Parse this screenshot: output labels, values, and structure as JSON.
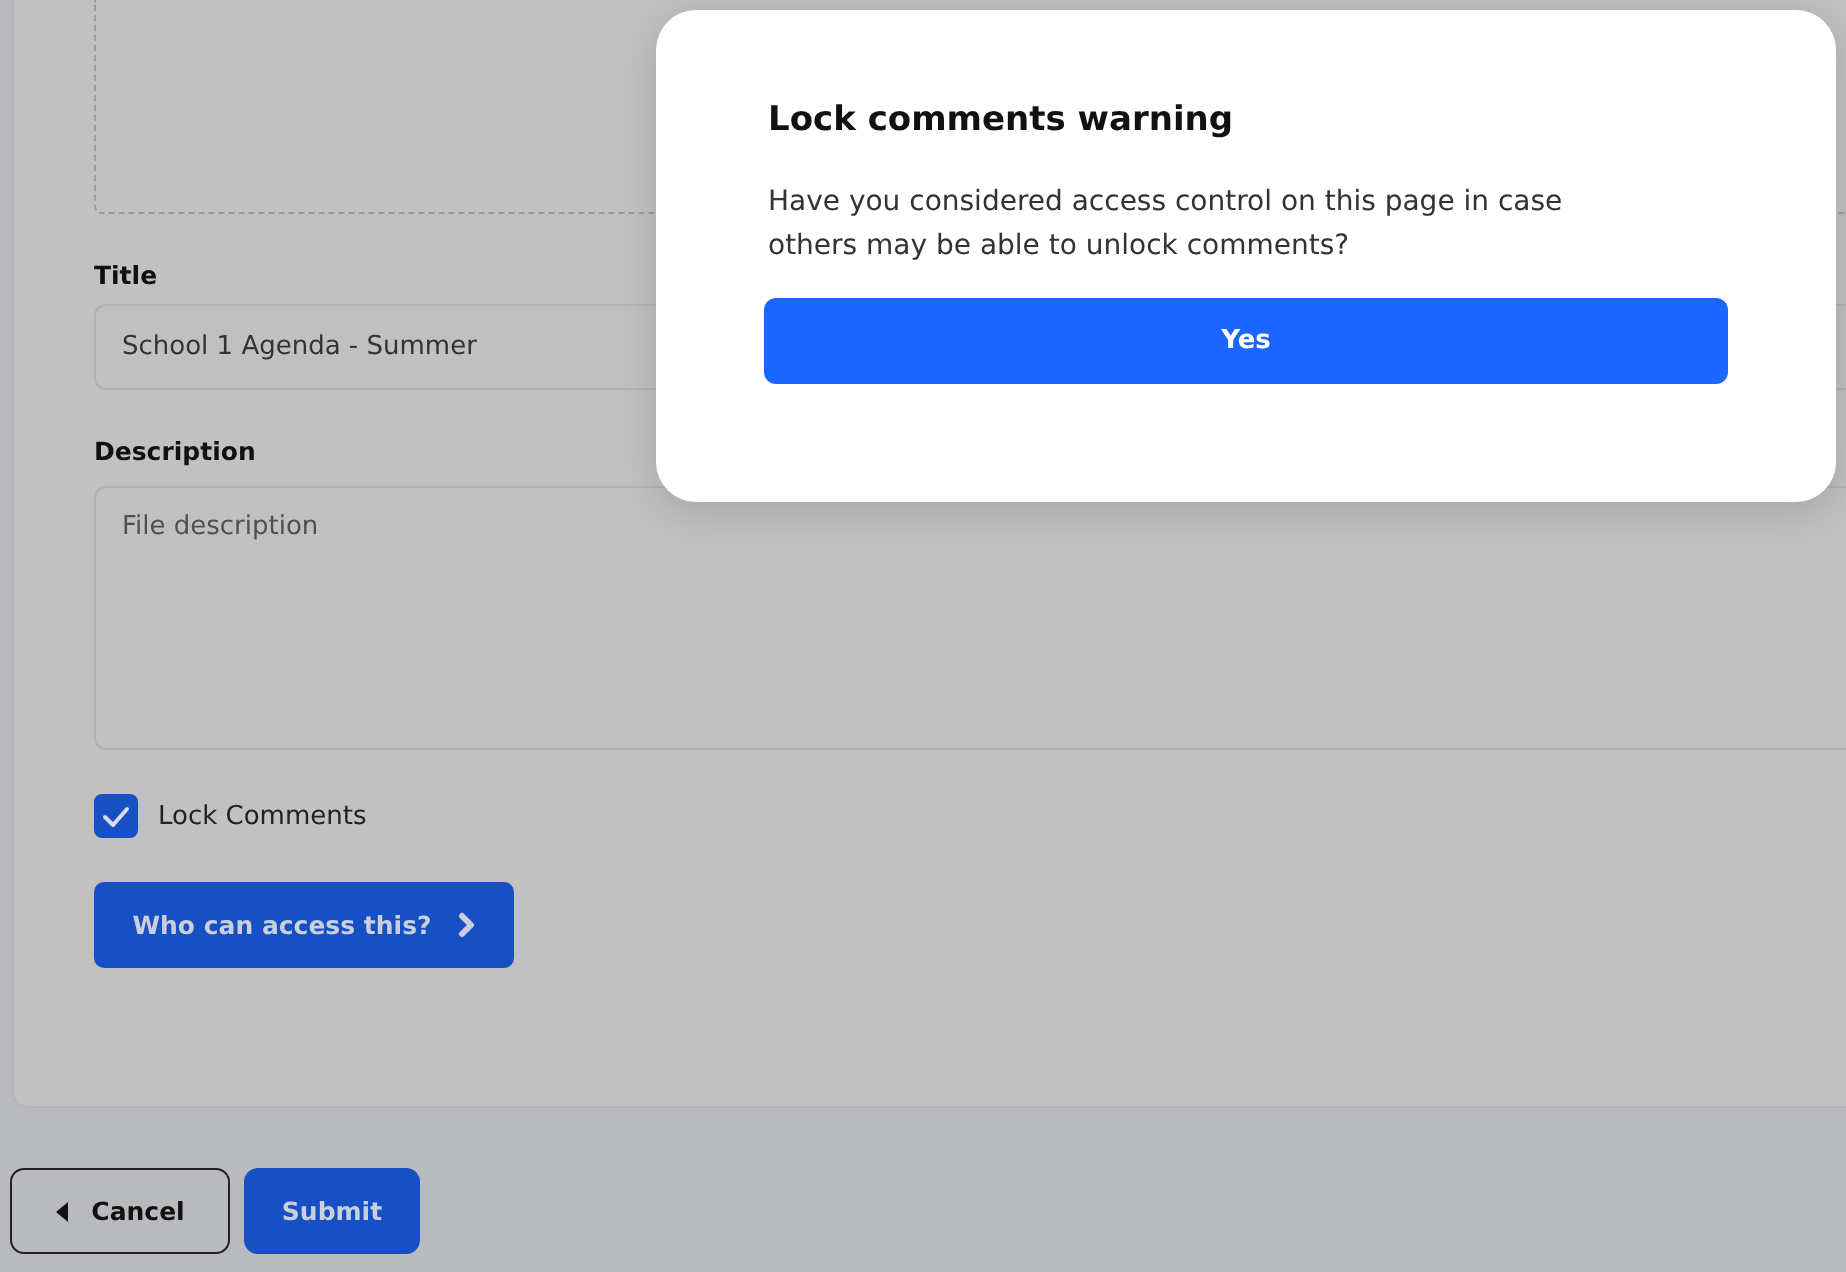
{
  "form": {
    "title_field": {
      "label": "Title",
      "value": "School 1 Agenda - Summer"
    },
    "description_field": {
      "label": "Description",
      "placeholder": "File description"
    },
    "lock_comments": {
      "label": "Lock Comments",
      "checked": true
    },
    "access_button": {
      "label": "Who can access this?"
    }
  },
  "footer_buttons": [
    {
      "label": "Cancel",
      "kind": "back"
    },
    {
      "label": "Submit",
      "kind": "primary"
    }
  ],
  "dialog": {
    "title": "Lock comments warning",
    "message": "Have you considered access control on this page in case others may be able to unlock comments?",
    "button": "Yes"
  }
}
